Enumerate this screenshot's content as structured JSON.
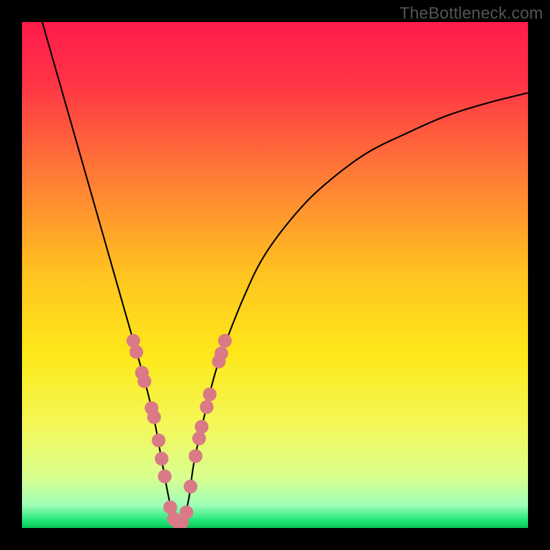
{
  "watermark": {
    "text": "TheBottleneck.com"
  },
  "chart_data": {
    "type": "line",
    "title": "",
    "xlabel": "",
    "ylabel": "",
    "xlim": [
      0,
      100
    ],
    "ylim": [
      0,
      100
    ],
    "gradient": {
      "stops": [
        {
          "pos": 0.0,
          "color": "#ff1b4b"
        },
        {
          "pos": 0.12,
          "color": "#ff3445"
        },
        {
          "pos": 0.3,
          "color": "#ff7a36"
        },
        {
          "pos": 0.5,
          "color": "#ffc41f"
        },
        {
          "pos": 0.66,
          "color": "#fde91a"
        },
        {
          "pos": 0.8,
          "color": "#f3f85a"
        },
        {
          "pos": 0.9,
          "color": "#d9ff8f"
        },
        {
          "pos": 0.955,
          "color": "#9fffb9"
        },
        {
          "pos": 0.985,
          "color": "#20e678"
        },
        {
          "pos": 1.0,
          "color": "#07c554"
        }
      ]
    },
    "series": [
      {
        "name": "bottleneck-curve",
        "x": [
          4,
          6,
          8,
          10,
          12,
          14,
          16,
          18,
          20,
          22,
          24,
          26,
          27.5,
          29,
          30,
          31,
          32,
          33,
          34,
          36,
          38,
          40,
          44,
          48,
          54,
          60,
          68,
          76,
          84,
          92,
          100
        ],
        "y": [
          100,
          93,
          86,
          79,
          72,
          65,
          58,
          51,
          44,
          37,
          30,
          22,
          14,
          6,
          2,
          1,
          2,
          6,
          13,
          22,
          30,
          36,
          46,
          54,
          62,
          68,
          74,
          78,
          81.5,
          84,
          86
        ]
      }
    ],
    "markers": {
      "name": "highlight-points",
      "color": "#d97a86",
      "radius_px": 10,
      "points": [
        {
          "x": 22.0,
          "y": 37.0
        },
        {
          "x": 22.6,
          "y": 34.8
        },
        {
          "x": 23.7,
          "y": 30.7
        },
        {
          "x": 24.2,
          "y": 29.0
        },
        {
          "x": 25.6,
          "y": 23.7
        },
        {
          "x": 26.1,
          "y": 21.9
        },
        {
          "x": 27.0,
          "y": 17.3
        },
        {
          "x": 27.6,
          "y": 13.7
        },
        {
          "x": 28.2,
          "y": 10.2
        },
        {
          "x": 29.3,
          "y": 4.1
        },
        {
          "x": 30.0,
          "y": 1.8
        },
        {
          "x": 30.8,
          "y": 1.1
        },
        {
          "x": 31.6,
          "y": 1.1
        },
        {
          "x": 32.5,
          "y": 3.1
        },
        {
          "x": 33.3,
          "y": 8.2
        },
        {
          "x": 34.3,
          "y": 14.2
        },
        {
          "x": 35.0,
          "y": 17.7
        },
        {
          "x": 35.5,
          "y": 20.0
        },
        {
          "x": 36.5,
          "y": 23.9
        },
        {
          "x": 37.1,
          "y": 26.4
        },
        {
          "x": 38.9,
          "y": 32.9
        },
        {
          "x": 39.4,
          "y": 34.5
        },
        {
          "x": 40.1,
          "y": 37.0
        }
      ]
    }
  }
}
